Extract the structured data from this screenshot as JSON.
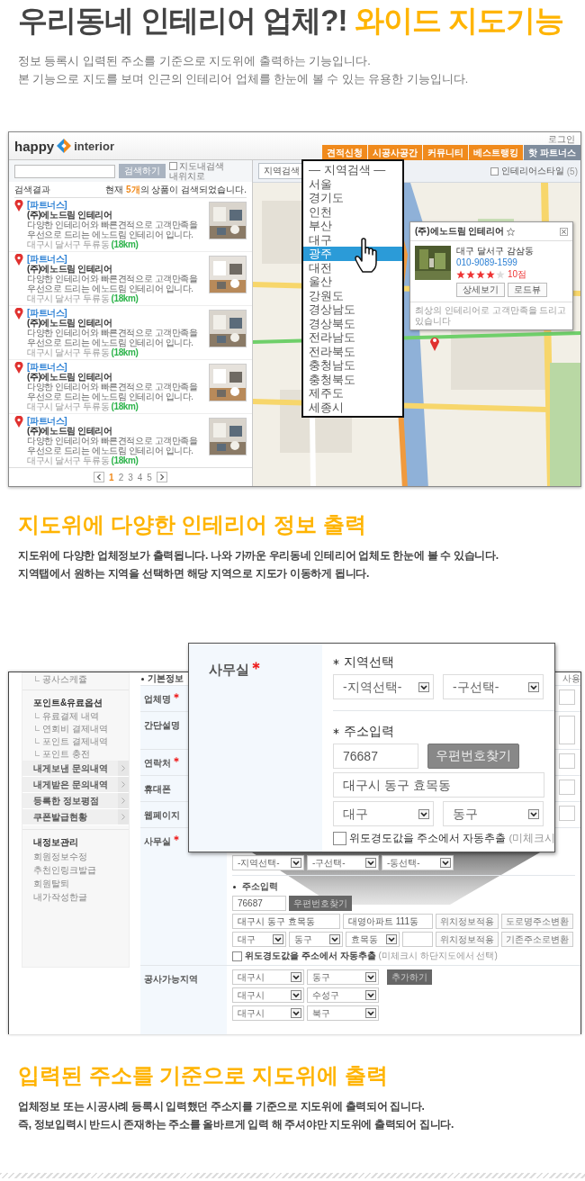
{
  "intro": {
    "kind": "lead",
    "title": "우리동네 인테리어 업체?! **와이드 지도기능**",
    "paragraphs": [
      "정보 등록시 입력된 주소를 기준으로 지도위에 출력하는 기능입니다.",
      "본 기능으로 지도를 보며 인근의 인테리어 업체를 한눈에 볼 수 있는 유용한 기능입니다."
    ]
  },
  "map_screenshot": {
    "logo": {
      "left": "happy",
      "right": "interior"
    },
    "login": "로그인",
    "nav": [
      {
        "label": "견적신청",
        "color": "#f08a1c"
      },
      {
        "label": "시공사공간",
        "color": "#f08a1c"
      },
      {
        "label": "커뮤니티",
        "color": "#f08a1c"
      },
      {
        "label": "베스트랭킹",
        "color": "#f08a1c"
      },
      {
        "label": "핫 파트너스",
        "color": "#7f8c9c"
      }
    ],
    "search": {
      "button": "검색하기",
      "option": {
        "label": "지도내검색",
        "checked": false
      },
      "location_link": "내위치로"
    },
    "results_header": {
      "label": "검색결과",
      "count": "현재 **5개**의 상품이 검색되었습니다."
    },
    "results": [
      {
        "tag": "[파트너스]",
        "name": "(주)에노드림 인테리어",
        "description": "다양한 인테리어와 빠른견적으로 고객만족을 우선으로 드리는 에노드림 인테리어 입니다.",
        "address": "대구시 달서구 두류동",
        "distance": "(18km)"
      },
      {
        "tag": "[파트너스]",
        "name": "(주)에노드림 인테리어",
        "description": "다양한 인테리어와 빠른견적으로 고객만족을 우선으로 드리는 에노드림 인테리어 입니다.",
        "address": "대구시 달서구 두류동",
        "distance": "(18km)"
      },
      {
        "tag": "[파트너스]",
        "name": "(주)에노드림 인테리어",
        "description": "다양한 인테리어와 빠른견적으로 고객만족을 우선으로 드리는 에노드림 인테리어 입니다.",
        "address": "대구시 달서구 두류동",
        "distance": "(18km)"
      },
      {
        "tag": "[파트너스]",
        "name": "(주)에노드림 인테리어",
        "description": "다양한 인테리어와 빠른견적으로 고객만족을 우선으로 드리는 에노드림 인테리어 입니다.",
        "address": "대구시 달서구 두류동",
        "distance": "(18km)"
      },
      {
        "tag": "[파트너스]",
        "name": "(주)에노드림 인테리어",
        "description": "다양한 인테리어와 빠른견적으로 고객만족을 우선으로 드리는 에노드림 인테리어 입니다.",
        "address": "대구시 달서구 두류동",
        "distance": "(18km)"
      }
    ],
    "pagination": {
      "pages": [
        {
          "label": "1",
          "selected": true
        },
        {
          "label": "2",
          "selected": false
        },
        {
          "label": "3",
          "selected": false
        },
        {
          "label": "4",
          "selected": false
        },
        {
          "label": "5",
          "selected": false
        }
      ]
    },
    "map_filters": {
      "region_button": "지역검색",
      "checkbox": {
        "label": "인테리어스타일",
        "count": "(5)",
        "checked": false
      }
    },
    "region_dropdown": {
      "heading": "— 지역검색 —",
      "options": [
        {
          "label": "서울",
          "selected": false
        },
        {
          "label": "경기도",
          "selected": false
        },
        {
          "label": "인천",
          "selected": false
        },
        {
          "label": "부산",
          "selected": false
        },
        {
          "label": "대구",
          "selected": false
        },
        {
          "label": "광주",
          "selected": true
        },
        {
          "label": "대전",
          "selected": false
        },
        {
          "label": "울산",
          "selected": false
        },
        {
          "label": "강원도",
          "selected": false
        },
        {
          "label": "경상남도",
          "selected": false
        },
        {
          "label": "경상북도",
          "selected": false
        },
        {
          "label": "전라남도",
          "selected": false
        },
        {
          "label": "전라북도",
          "selected": false
        },
        {
          "label": "충청남도",
          "selected": false
        },
        {
          "label": "충청북도",
          "selected": false
        },
        {
          "label": "제주도",
          "selected": false
        },
        {
          "label": "세종시",
          "selected": false
        }
      ]
    },
    "map_popup": {
      "title": "(주)에노드림 인테리어",
      "address": "대구 달서구 감삼동",
      "phone": "010-9089-1599",
      "stars": 4,
      "score": "10점",
      "buttons": [
        "상세보기",
        "로드뷰"
      ],
      "footer": "최상의 인테리어로 고객만족을 드리고 있습니다"
    }
  },
  "map_section": {
    "kind": "feature",
    "title": "지도위에 다양한 인테리어 정보 출력",
    "paragraphs": [
      "지도위에 다양한 업체정보가 출력됩니다. 나와 가까운 우리동네 인테리어 업체도 한눈에 볼 수 있습니다.",
      "지역탭에서 원하는 지역을 선택하면 해당 지역으로 지도가 이동하게 됩니다."
    ]
  },
  "form_screenshot": {
    "sidebar": [
      {
        "kind": "sub",
        "label": "공사스케쥴"
      },
      {
        "kind": "group",
        "label": "포인트&유료옵션"
      },
      {
        "kind": "sub",
        "label": "유료결제 내역"
      },
      {
        "kind": "sub",
        "label": "연회비 결제내역"
      },
      {
        "kind": "sub",
        "label": "포인트 결제내역"
      },
      {
        "kind": "sub",
        "label": "포인트 충전"
      },
      {
        "kind": "menu",
        "label": "내게보낸 문의내역"
      },
      {
        "kind": "menu",
        "label": "내게받은 문의내역"
      },
      {
        "kind": "menu",
        "label": "등록한 정보평점"
      },
      {
        "kind": "menu",
        "label": "쿠폰발급현황"
      },
      {
        "kind": "group",
        "label": "내정보관리"
      },
      {
        "kind": "link",
        "label": "회원정보수정"
      },
      {
        "kind": "link",
        "label": "추천인링크발급"
      },
      {
        "kind": "link",
        "label": "회원탈퇴"
      },
      {
        "kind": "link",
        "label": "내가작성한글"
      }
    ],
    "section_label": "기본정보",
    "corner_label": "사용",
    "rows": [
      {
        "kind": "input",
        "label": "업체명",
        "required": true
      },
      {
        "kind": "textarea",
        "label": "간단설명",
        "required": false
      },
      {
        "kind": "input",
        "label": "연락처",
        "required": true
      },
      {
        "kind": "input",
        "label": "휴대폰",
        "required": false
      },
      {
        "kind": "input",
        "label": "웹페이지",
        "required": false
      },
      {
        "kind": "address",
        "label": "사무실",
        "required": true
      },
      {
        "kind": "areas",
        "label": "공사가능지역",
        "required": false
      }
    ],
    "address": {
      "region_selects": [
        "-지역선택-",
        "-구선택-",
        "-동선택-"
      ],
      "heading": "주소입력",
      "zip": "76687",
      "zip_button": "우편번호찾기",
      "address1": "대구시 동구 효목동",
      "address2": "대영아파트 111동",
      "buttons1": [
        "위치정보적용",
        "도로명주소변환"
      ],
      "selects": [
        "대구",
        "동구",
        "효목동"
      ],
      "buttons2": [
        "위치정보적용",
        "기존주소로변환"
      ],
      "auto_check": {
        "label": "위도경도값을 주소에서 자동추출",
        "note": "(미체크시 하단지도에서 선택)",
        "checked": false
      }
    },
    "areas": {
      "rows": [
        {
          "city": "대구시",
          "district": "동구"
        },
        {
          "city": "대구시",
          "district": "수성구"
        },
        {
          "city": "대구시",
          "district": "북구"
        }
      ],
      "add_button": "추가하기"
    },
    "zoom_panel": {
      "label": "사무실",
      "required": true,
      "region_heading": "지역선택",
      "region_selects": [
        "-지역선택-",
        "-구선택-"
      ],
      "address_heading": "주소입력",
      "zip": "76687",
      "zip_button": "우편번호찾기",
      "address": "대구시 동구 효목동",
      "selects": [
        "대구",
        "동구"
      ],
      "auto_check": {
        "label": "위도경도값을 주소에서 자동추출",
        "note": "(미체크시",
        "checked": false
      }
    }
  },
  "address_section": {
    "kind": "feature",
    "title": "입력된 주소를 기준으로 지도위에 출력",
    "paragraphs": [
      "업체정보 또는 시공사례 등록시 입력했던 주소지를 기준으로 지도위에 출력되어 집니다.",
      "즉, 정보입력시 반드시 존재하는 주소를 올바르게 입력 해 주셔야만 지도위에 출력되어 집니다."
    ]
  }
}
